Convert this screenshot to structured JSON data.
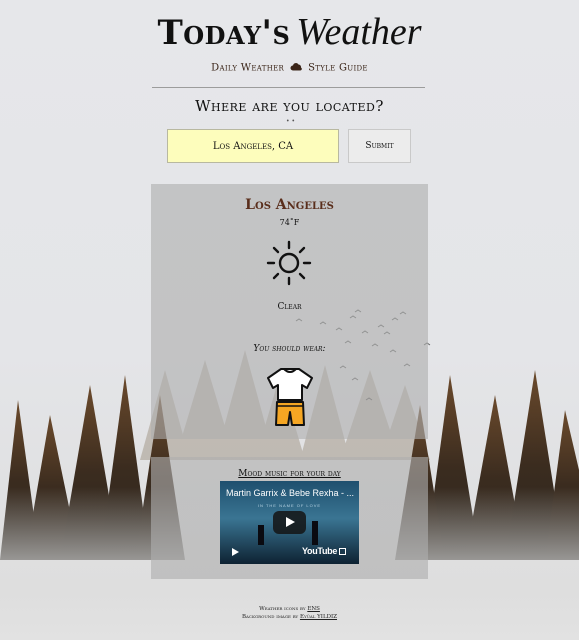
{
  "header": {
    "title_prefix": "Today's",
    "title_script": "Weather",
    "subtitle_left": "Daily Weather",
    "subtitle_icon": "cloud-icon",
    "subtitle_right": "Style Guide"
  },
  "location": {
    "question": "Where are you located?",
    "dots": "• •",
    "input_value": "Los Angeles, CA",
    "submit_label": "Submit"
  },
  "weather": {
    "city": "Los Angeles",
    "temperature": "74˚F",
    "condition_icon": "sun-icon",
    "condition": "Clear",
    "wear_prompt": "You should wear:",
    "outfit_icon": "tshirt-shorts-icon"
  },
  "music": {
    "heading": "Mood music for your day",
    "video_title": "Martin Garrix & Bebe Rexha - ...",
    "video_caption": "IN THE NAME OF LOVE",
    "video_brand": "YouTube"
  },
  "credits": {
    "icons_prefix": "Weather icons by",
    "icons_author": "ENS",
    "image_prefix": "Background image by",
    "image_author": "Eyüal YILDIZ"
  },
  "colors": {
    "input_bg": "#fdfdbc",
    "city_text": "#5a2e1c",
    "outfit_shirt": "#ffffff",
    "outfit_shorts": "#f5a623"
  }
}
